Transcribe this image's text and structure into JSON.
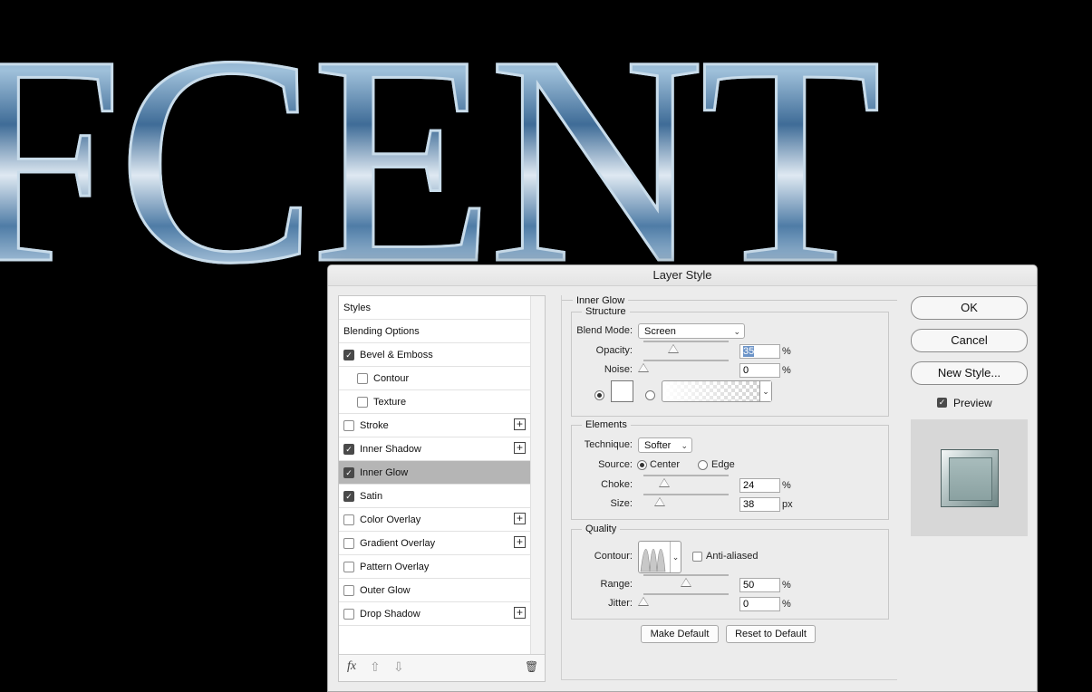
{
  "background": {
    "text": "FCENT"
  },
  "dialog": {
    "title": "Layer Style"
  },
  "sidebar": {
    "items": [
      {
        "label": "Styles"
      },
      {
        "label": "Blending Options"
      },
      {
        "label": "Bevel & Emboss",
        "checked": true
      },
      {
        "label": "Contour",
        "checked": false
      },
      {
        "label": "Texture",
        "checked": false
      },
      {
        "label": "Stroke",
        "checked": false,
        "plus": true
      },
      {
        "label": "Inner Shadow",
        "checked": true,
        "plus": true
      },
      {
        "label": "Inner Glow",
        "checked": true,
        "active": true
      },
      {
        "label": "Satin",
        "checked": true
      },
      {
        "label": "Color Overlay",
        "checked": false,
        "plus": true
      },
      {
        "label": "Gradient Overlay",
        "checked": false,
        "plus": true
      },
      {
        "label": "Pattern Overlay",
        "checked": false
      },
      {
        "label": "Outer Glow",
        "checked": false
      },
      {
        "label": "Drop Shadow",
        "checked": false,
        "plus": true
      }
    ],
    "footer": {
      "fx": "fx",
      "up": "⇧",
      "down": "⇩",
      "trash": "🗑"
    }
  },
  "panel": {
    "title": "Inner Glow",
    "structure": {
      "title": "Structure",
      "blend_mode_label": "Blend Mode:",
      "blend_mode": "Screen",
      "opacity_label": "Opacity:",
      "opacity": "35",
      "opacity_level": 0.35,
      "noise_label": "Noise:",
      "noise": "0",
      "noise_level": 0,
      "percent": "%"
    },
    "elements": {
      "title": "Elements",
      "technique_label": "Technique:",
      "technique": "Softer",
      "source_label": "Source:",
      "center": "Center",
      "edge": "Edge",
      "choke_label": "Choke:",
      "choke": "24",
      "choke_level": 0.24,
      "size_label": "Size:",
      "size": "38",
      "size_level": 0.19,
      "percent": "%",
      "px": "px"
    },
    "quality": {
      "title": "Quality",
      "contour_label": "Contour:",
      "anti_aliased": "Anti-aliased",
      "range_label": "Range:",
      "range": "50",
      "range_level": 0.5,
      "jitter_label": "Jitter:",
      "jitter": "0",
      "jitter_level": 0,
      "percent": "%"
    },
    "make_default": "Make Default",
    "reset_default": "Reset to Default"
  },
  "buttons": {
    "ok": "OK",
    "cancel": "Cancel",
    "new_style": "New Style...",
    "preview": "Preview"
  },
  "icons": {
    "checkmark": "✓",
    "chevron": "⌄",
    "plus": "+"
  }
}
